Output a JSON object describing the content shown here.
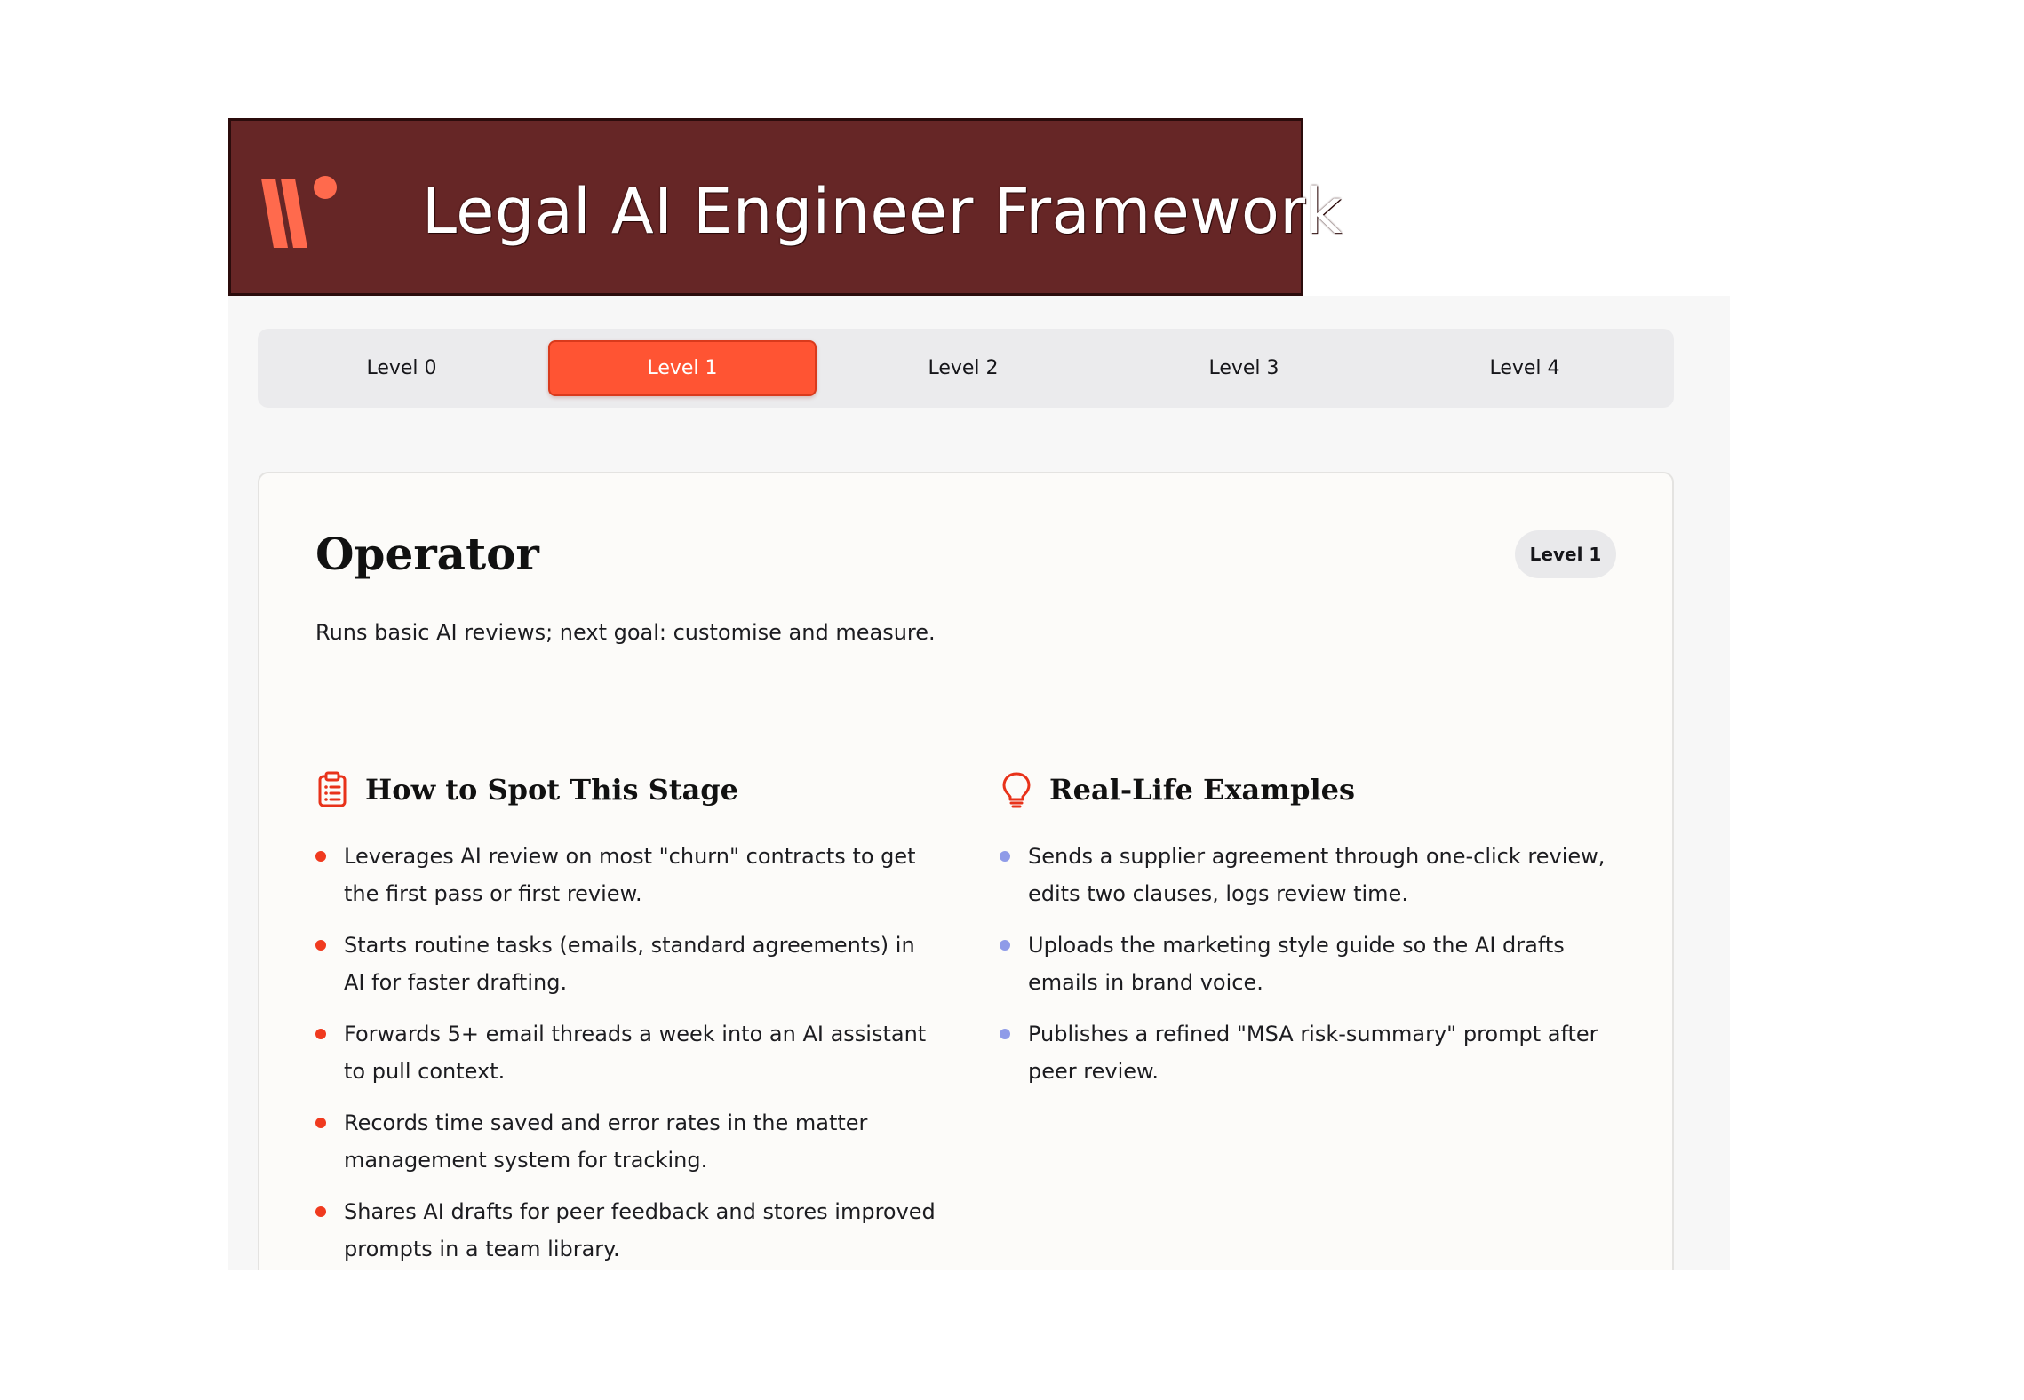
{
  "header": {
    "title": "Legal AI Engineer Framework",
    "logo_icon": "w-brand-logo-icon",
    "background_color": "#662626"
  },
  "tabs": [
    {
      "label": "Level 0",
      "active": false
    },
    {
      "label": "Level 1",
      "active": true
    },
    {
      "label": "Level 2",
      "active": false
    },
    {
      "label": "Level 3",
      "active": false
    },
    {
      "label": "Level 4",
      "active": false
    }
  ],
  "accent_color": "#ff5433",
  "card": {
    "title": "Operator",
    "badge": "Level 1",
    "description": "Runs basic AI reviews; next goal: customise and measure.",
    "spot": {
      "icon": "clipboard-list-icon",
      "title": "How to Spot This Stage",
      "items": [
        "Leverages AI review on most \"churn\" contracts to get the first pass or first review.",
        "Starts routine tasks (emails, standard agreements) in AI for faster drafting.",
        "Forwards 5+ email threads a week into an AI assistant to pull context.",
        "Records time saved and error rates in the matter management system for tracking.",
        "Shares AI drafts for peer feedback and stores improved prompts in a team library."
      ]
    },
    "examples": {
      "icon": "lightbulb-icon",
      "title": "Real-Life Examples",
      "items": [
        "Sends a supplier agreement through one-click review, edits two clauses, logs review time.",
        "Uploads the marketing style guide so the AI drafts emails in brand voice.",
        "Publishes a refined \"MSA risk-summary\" prompt after peer review."
      ]
    }
  }
}
